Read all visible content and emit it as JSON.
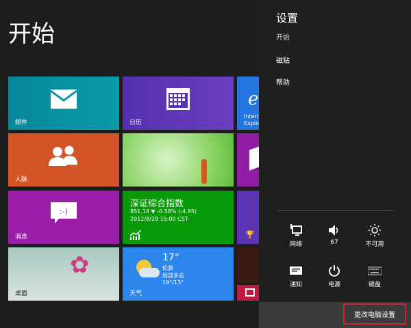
{
  "start": {
    "title": "开始"
  },
  "tiles": {
    "mail": {
      "label": "邮件",
      "color": "#0a93a5"
    },
    "calendar": {
      "label": "日历",
      "color": "#5b34b5"
    },
    "ie": {
      "label_line1": "Intern",
      "label_line2": "Explo",
      "color": "#2575e0"
    },
    "people": {
      "label": "人脉",
      "color": "#d35527"
    },
    "messaging": {
      "label": "消息",
      "color": "#9b1ea9"
    },
    "finance": {
      "title": "深证综合指数",
      "quote": "851.14 ▼ -0.58% (-4.95)",
      "time": "2012/8/29 15:00 CST",
      "color": "#089a08"
    },
    "desktop": {
      "label": "桌面"
    },
    "weather": {
      "temp": "17°",
      "city": "伦敦",
      "condition": "局部多云",
      "range": "19°/13°",
      "label": "天气",
      "color": "#2d86ec"
    }
  },
  "settings": {
    "title": "设置",
    "context": "开始",
    "items": [
      "磁贴",
      "帮助"
    ],
    "quick": [
      {
        "icon": "network-icon",
        "label": "网络"
      },
      {
        "icon": "volume-icon",
        "label": "67"
      },
      {
        "icon": "brightness-icon",
        "label": "不可用"
      },
      {
        "icon": "notifications-icon",
        "label": "通知"
      },
      {
        "icon": "power-icon",
        "label": "电源"
      },
      {
        "icon": "keyboard-icon",
        "label": "键盘"
      }
    ],
    "change_pc_settings": "更改电脑设置"
  }
}
